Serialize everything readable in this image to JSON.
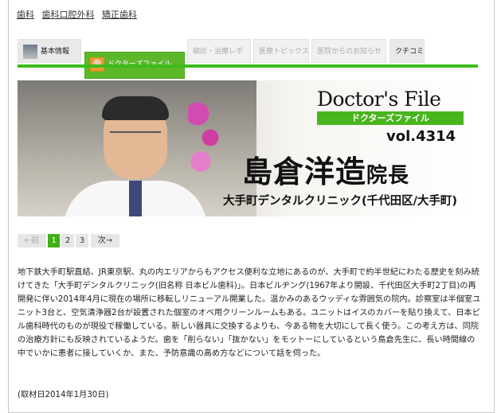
{
  "categories": [
    "歯科",
    "歯科口腔外科",
    "矯正歯科"
  ],
  "tabs": {
    "basic": "基本情報",
    "doctor": "ドクターズファイル",
    "checkup": "検診・治療レポ",
    "topics": "医療トピックス",
    "notice": "医院からのお知らせ",
    "review": "クチコミ"
  },
  "hero": {
    "logo_title": "Doctor's File",
    "logo_sub": "ドクターズファイル",
    "vol": "vol.4314",
    "name": "島倉洋造",
    "role": "院長",
    "clinic": "大手町デンタルクリニック(千代田区/大手町)"
  },
  "pager": {
    "prev": "←前",
    "pages": [
      "1",
      "2",
      "3"
    ],
    "current": "1",
    "next": "次→"
  },
  "article": "地下鉄大手町駅直結、JR東京駅、丸の内エリアからもアクセス便利な立地にあるのが、大手町で約半世紀にわたる歴史を刻み続けてきた「大手町デンタルクリニック(旧名称 日本ビル歯科)」。日本ビルヂング(1967年より開設、千代田区大手町2丁目)の再開発に伴い2014年4月に現在の場所に移転しリニューアル開業した。温かみのあるウッディな雰囲気の院内。診察室は半個室ユニット3台と、空気清浄器2台が設置された個室のオペ用クリーンルームもある。ユニットはイスのカバーを貼り換えて、日本ビル歯科時代のものが現役で稼働している。新しい器具に交換するよりも、今ある物を大切にして長く使う。この考え方は、同院の治療方針にも反映されているようだ。歯を「削らない」「抜かない」をモットーにしているという島倉先生に、長い時間線の中でいかに患者に接していくか、また、予防意識の高め方などについて話を伺った。",
  "interview_date": "(取材日2014年1月30日)"
}
